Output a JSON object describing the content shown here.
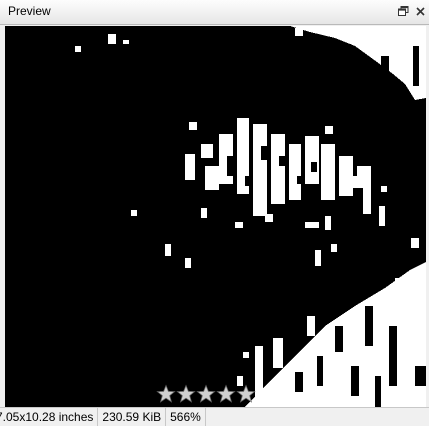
{
  "panel": {
    "title": "Preview",
    "restore_icon": "restore-window-icon",
    "close_icon": "close-icon"
  },
  "preview": {
    "background": "#000000",
    "foreground": "#ffffff"
  },
  "rating": {
    "max": 5,
    "value": 0,
    "star_color": "#c8c8c8"
  },
  "status": {
    "dimensions": "7.05x10.28 inches",
    "file_size": "230.59 KiB",
    "zoom": "566%"
  }
}
